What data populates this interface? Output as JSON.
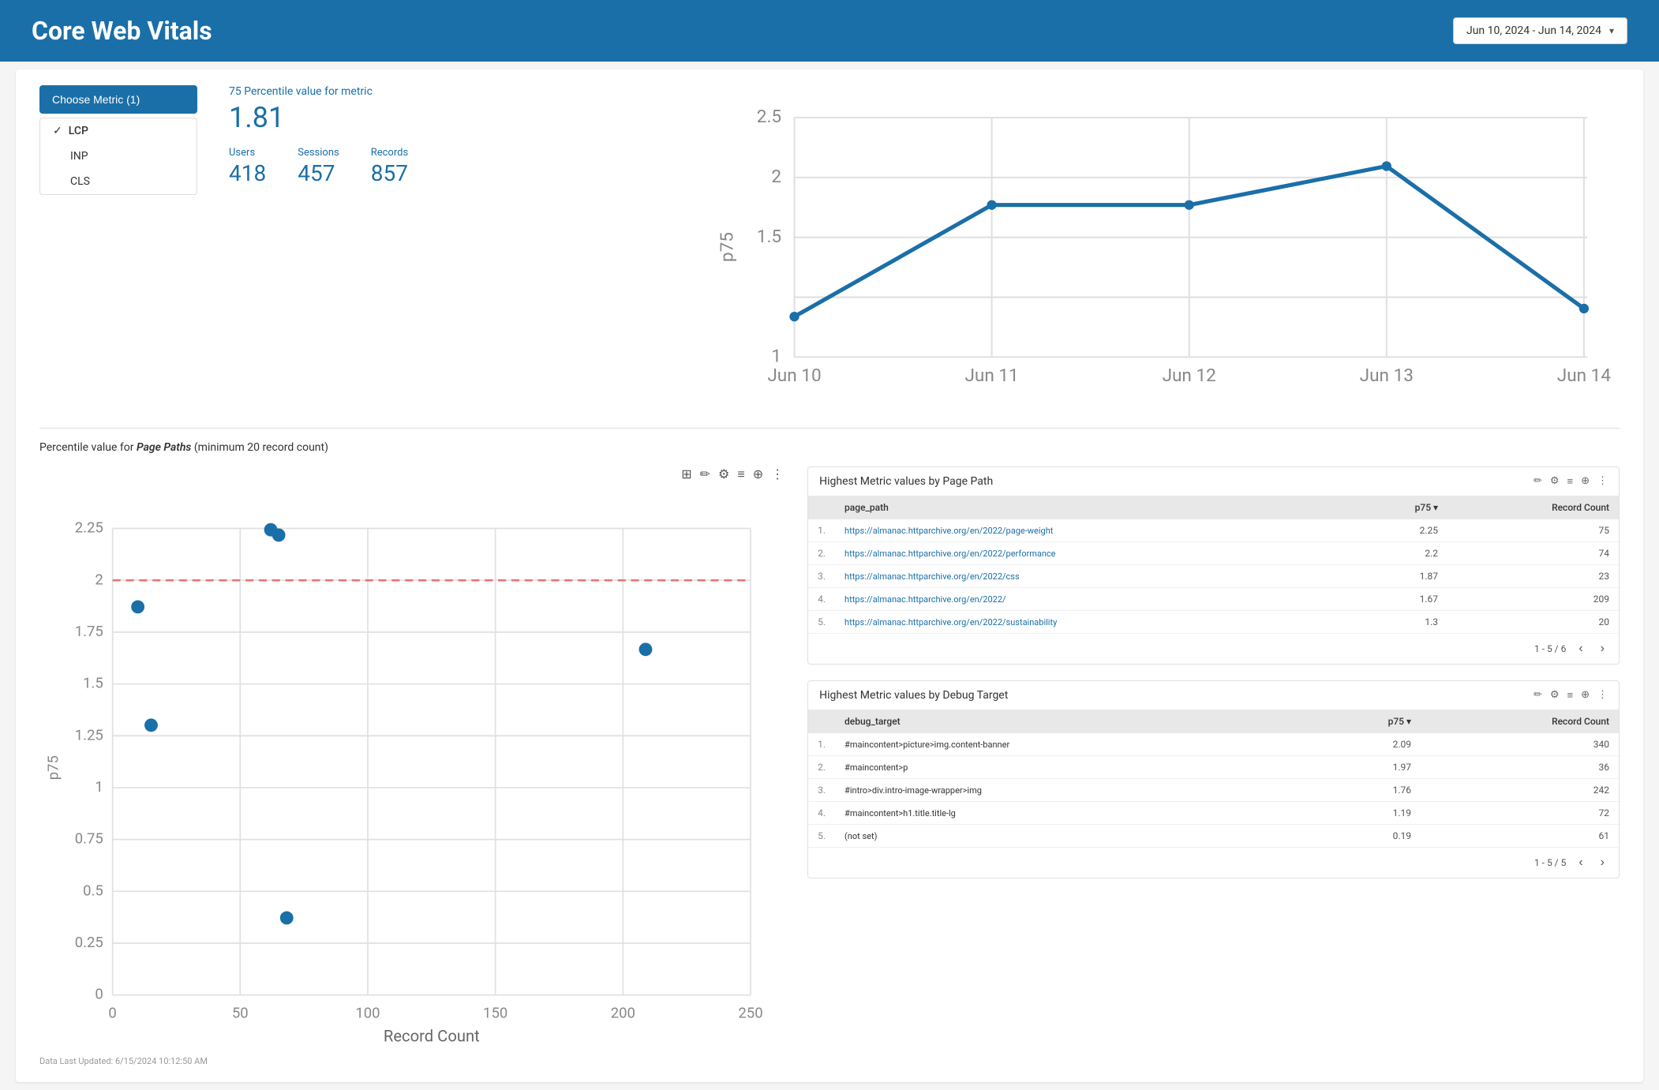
{
  "header": {
    "title": "Core Web Vitals",
    "date_range": "Jun 10, 2024 - Jun 14, 2024"
  },
  "metric_selector": {
    "button_label": "Choose Metric (1)",
    "options": [
      {
        "id": "lcp",
        "label": "LCP",
        "active": true
      },
      {
        "id": "inp",
        "label": "INP",
        "active": false
      },
      {
        "id": "cls",
        "label": "CLS",
        "active": false
      }
    ]
  },
  "stats": {
    "percentile_label": "75 Percentile value for metric",
    "percentile_value": "1.81",
    "users_label": "Users",
    "users_value": "418",
    "sessions_label": "Sessions",
    "sessions_value": "457",
    "records_label": "Records",
    "records_value": "857"
  },
  "section_title_pre": "Percentile value for ",
  "section_title_em": "Page Paths",
  "section_title_post": " (minimum 20 record count)",
  "line_chart": {
    "x_labels": [
      "Jun 10",
      "Jun 11",
      "Jun 12",
      "Jun 13",
      "Jun 14"
    ],
    "y_min": 1,
    "y_max": 2.5,
    "y_labels": [
      "1",
      "1.5",
      "2",
      "2.5"
    ],
    "data_points": [
      {
        "x": "Jun 10",
        "y": 1.25
      },
      {
        "x": "Jun 11",
        "y": 1.95
      },
      {
        "x": "Jun 12",
        "y": 1.95
      },
      {
        "x": "Jun 13",
        "y": 2.2
      },
      {
        "x": "Jun 14",
        "y": 1.3
      }
    ],
    "y_axis_label": "p75"
  },
  "scatter_chart": {
    "x_label": "Record Count",
    "y_label": "p75",
    "x_max": 250,
    "y_max": 2.25,
    "x_ticks": [
      0,
      50,
      100,
      150,
      200,
      250
    ],
    "y_ticks": [
      0,
      0.25,
      0.5,
      0.75,
      1,
      1.25,
      1.5,
      1.75,
      2,
      2.25
    ],
    "data_points": [
      {
        "x": 10,
        "y": 1.87,
        "label": ""
      },
      {
        "x": 15,
        "y": 1.3,
        "label": ""
      },
      {
        "x": 62,
        "y": 2.25,
        "label": ""
      },
      {
        "x": 65,
        "y": 2.22,
        "label": ""
      },
      {
        "x": 68,
        "y": 0.37,
        "label": ""
      },
      {
        "x": 209,
        "y": 1.67,
        "label": ""
      }
    ],
    "reference_line_y": 2.0
  },
  "page_paths_table": {
    "title": "Highest Metric values by Page Path",
    "columns": [
      "page_path",
      "p75",
      "Record Count"
    ],
    "rows": [
      {
        "num": "1.",
        "path": "https://almanac.httparchive.org/en/2022/page-weight",
        "p75": "2.25",
        "count": "75"
      },
      {
        "num": "2.",
        "path": "https://almanac.httparchive.org/en/2022/performance",
        "p75": "2.2",
        "count": "74"
      },
      {
        "num": "3.",
        "path": "https://almanac.httparchive.org/en/2022/css",
        "p75": "1.87",
        "count": "23"
      },
      {
        "num": "4.",
        "path": "https://almanac.httparchive.org/en/2022/",
        "p75": "1.67",
        "count": "209"
      },
      {
        "num": "5.",
        "path": "https://almanac.httparchive.org/en/2022/sustainability",
        "p75": "1.3",
        "count": "20"
      }
    ],
    "pagination": "1 - 5 / 6"
  },
  "debug_target_table": {
    "title": "Highest Metric values by Debug Target",
    "columns": [
      "debug_target",
      "p75",
      "Record Count"
    ],
    "rows": [
      {
        "num": "1.",
        "target": "#maincontent>picture>img.content-banner",
        "p75": "2.09",
        "count": "340"
      },
      {
        "num": "2.",
        "target": "#maincontent>p",
        "p75": "1.97",
        "count": "36"
      },
      {
        "num": "3.",
        "target": "#intro>div.intro-image-wrapper>img",
        "p75": "1.76",
        "count": "242"
      },
      {
        "num": "4.",
        "target": "#maincontent>h1.title.title-lg",
        "p75": "1.19",
        "count": "72"
      },
      {
        "num": "5.",
        "target": "(not set)",
        "p75": "0.19",
        "count": "61"
      }
    ],
    "pagination": "1 - 5 / 5"
  },
  "footer": {
    "text": "Data Last Updated: 6/15/2024 10:12:50 AM"
  },
  "icons": {
    "pencil": "✏",
    "sliders": "⚙",
    "filter": "≡",
    "search": "🔍",
    "more": "⋮",
    "select": "⊞",
    "chevron_left": "‹",
    "chevron_right": "›",
    "dropdown_arrow": "▾",
    "checkmark": "✓"
  }
}
